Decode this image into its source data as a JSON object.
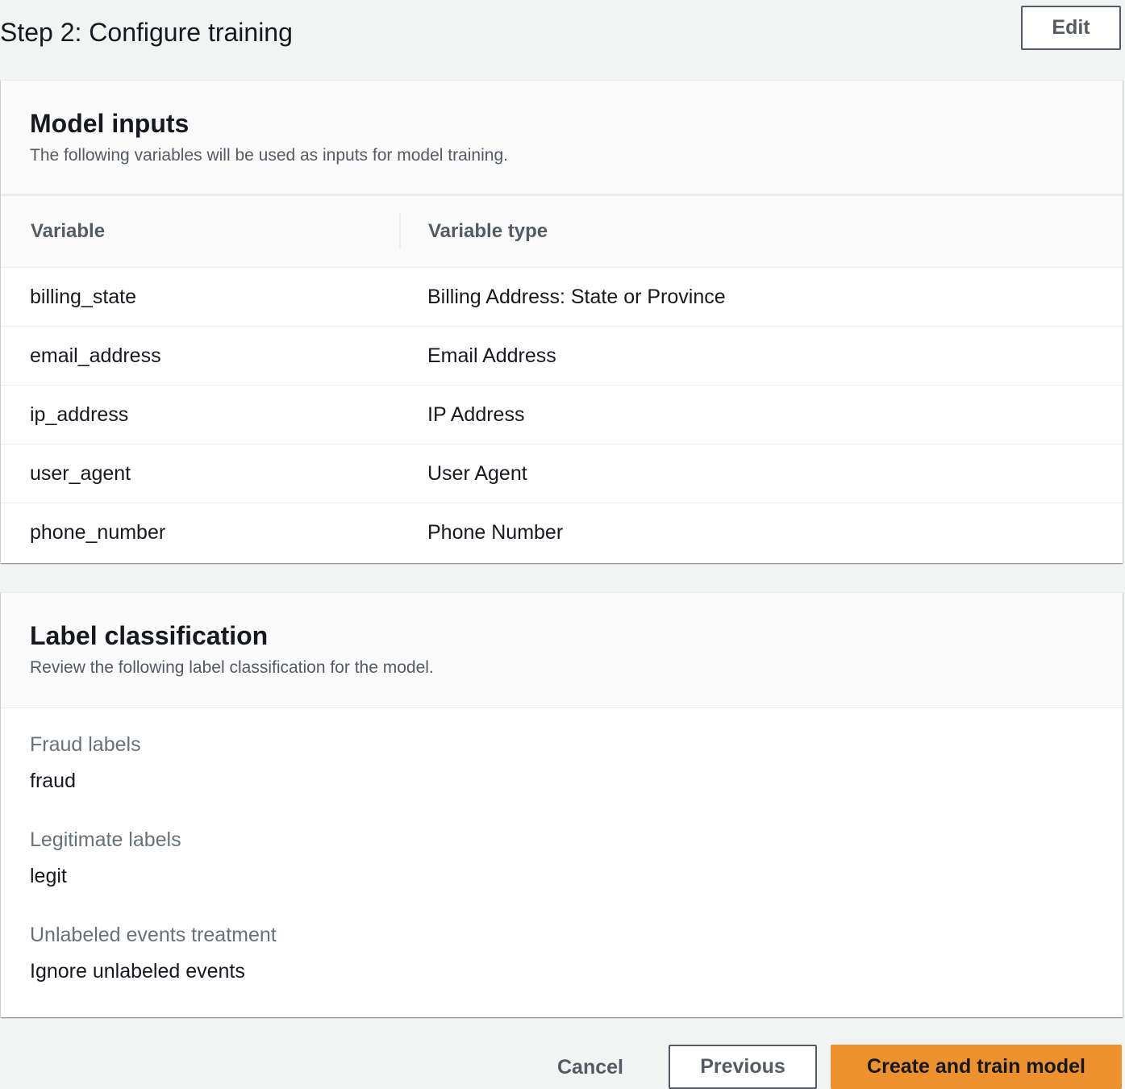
{
  "header": {
    "title": "Step 2: Configure training",
    "edit_label": "Edit"
  },
  "model_inputs": {
    "title": "Model inputs",
    "description": "The following variables will be used as inputs for model training.",
    "columns": [
      "Variable",
      "Variable type"
    ],
    "rows": [
      {
        "variable": "billing_state",
        "type": "Billing Address: State or Province"
      },
      {
        "variable": "email_address",
        "type": "Email Address"
      },
      {
        "variable": "ip_address",
        "type": "IP Address"
      },
      {
        "variable": "user_agent",
        "type": "User Agent"
      },
      {
        "variable": "phone_number",
        "type": "Phone Number"
      }
    ]
  },
  "label_classification": {
    "title": "Label classification",
    "description": "Review the following label classification for the model.",
    "fields": [
      {
        "key": "Fraud labels",
        "value": "fraud"
      },
      {
        "key": "Legitimate labels",
        "value": "legit"
      },
      {
        "key": "Unlabeled events treatment",
        "value": "Ignore unlabeled events"
      }
    ]
  },
  "footer": {
    "cancel_label": "Cancel",
    "previous_label": "Previous",
    "create_label": "Create and train model"
  },
  "colors": {
    "background": "#f2f3f3",
    "primary_button": "#ec912e",
    "text": "#16191f",
    "secondary_text": "#545b64"
  }
}
